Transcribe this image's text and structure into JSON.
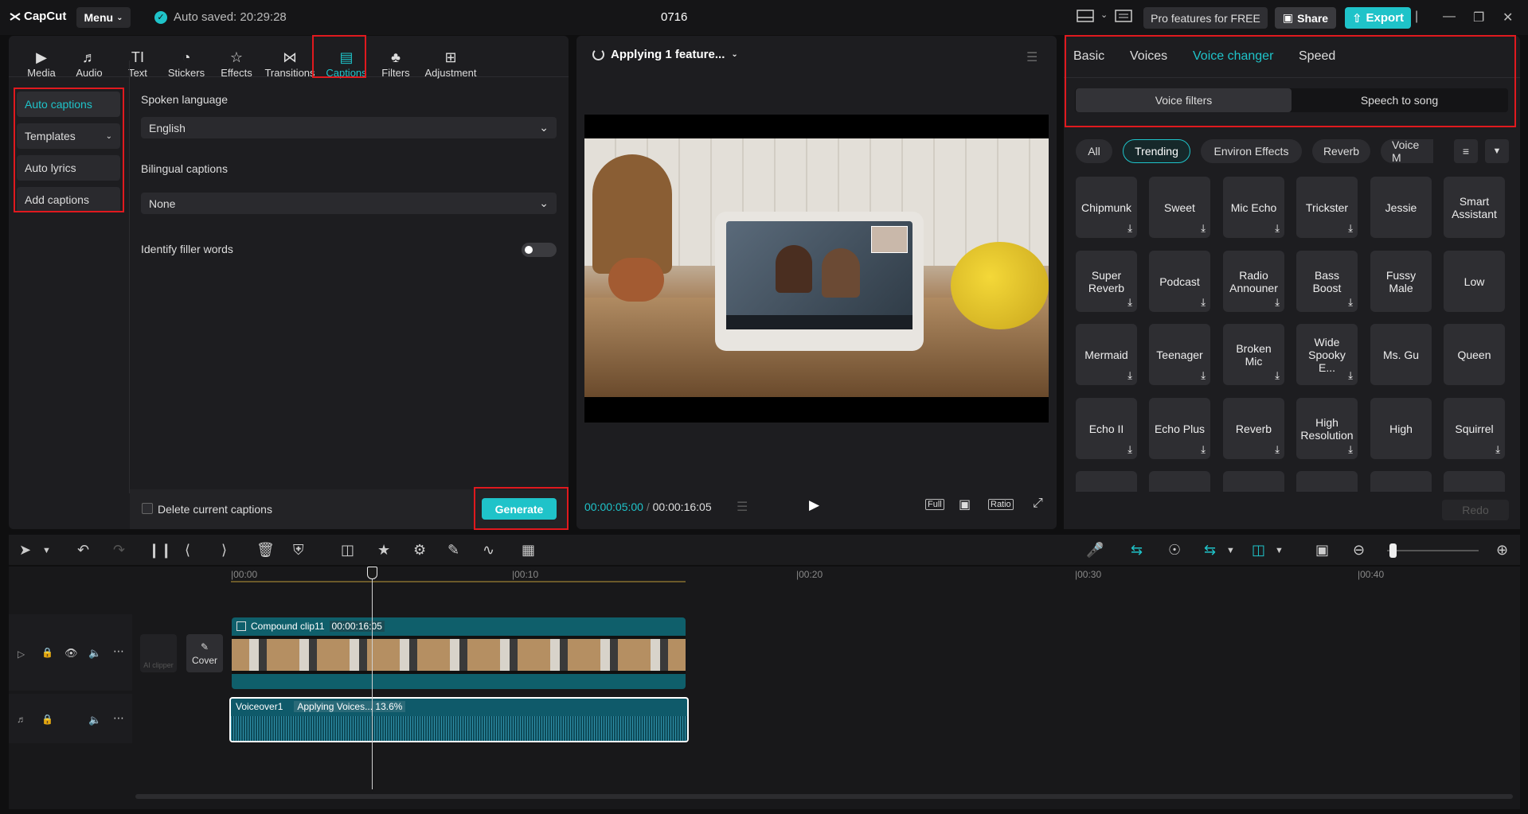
{
  "app": {
    "logo": "CapCut",
    "menu_label": "Menu",
    "autosave": "Auto saved: 20:29:28",
    "project_title": "0716",
    "pro_label": "Pro features for FREE",
    "share_label": "Share",
    "export_label": "Export"
  },
  "toolbar": [
    {
      "label": "Media",
      "icon": "media-icon"
    },
    {
      "label": "Audio",
      "icon": "audio-icon"
    },
    {
      "label": "Text",
      "icon": "text-icon"
    },
    {
      "label": "Stickers",
      "icon": "stickers-icon"
    },
    {
      "label": "Effects",
      "icon": "effects-icon"
    },
    {
      "label": "Transitions",
      "icon": "transitions-icon"
    },
    {
      "label": "Captions",
      "icon": "captions-icon"
    },
    {
      "label": "Filters",
      "icon": "filters-icon"
    },
    {
      "label": "Adjustment",
      "icon": "adjustment-icon"
    }
  ],
  "captions_sidebar": [
    "Auto captions",
    "Templates",
    "Auto lyrics",
    "Add captions"
  ],
  "captions_form": {
    "spoken_language_label": "Spoken language",
    "spoken_language_value": "English",
    "bilingual_label": "Bilingual captions",
    "bilingual_value": "None",
    "filler_label": "Identify filler words",
    "delete_label": "Delete current captions",
    "generate_label": "Generate"
  },
  "player": {
    "status": "Applying 1 feature...",
    "current_time": "00:00:05:00",
    "total_time": "00:00:16:05",
    "full_label": "Full",
    "ratio_label": "Ratio"
  },
  "right_panel": {
    "tabs": [
      "Basic",
      "Voices",
      "Voice changer",
      "Speed"
    ],
    "segments": [
      "Voice filters",
      "Speech to song"
    ],
    "chips": [
      "All",
      "Trending",
      "Environ Effects",
      "Reverb",
      "Voice M"
    ],
    "cards": [
      "Chipmunk",
      "Sweet",
      "Mic Echo",
      "Trickster",
      "Jessie",
      "Smart Assistant",
      "Super Reverb",
      "Podcast",
      "Radio Announer",
      "Bass Boost",
      "Fussy Male",
      "Low",
      "Mermaid",
      "Teenager",
      "Broken Mic",
      "Wide Spooky E...",
      "Ms. Gu",
      "Queen",
      "Echo II",
      "Echo Plus",
      "Reverb",
      "High Resolution",
      "High",
      "Squirrel"
    ],
    "redo_label": "Redo"
  },
  "timeline": {
    "ruler": [
      "00:00",
      "00:10",
      "00:20",
      "00:30",
      "00:40"
    ],
    "video_clip_name": "Compound clip11",
    "video_clip_duration": "00:00:16:05",
    "audio_clip_name": "Voiceover1",
    "audio_clip_status": "Applying Voices... 13.6%",
    "cover_label": "Cover",
    "ai_clipper_label": "AI clipper"
  },
  "colors": {
    "accent": "#1fc3c9",
    "highlight": "#e0191e"
  }
}
